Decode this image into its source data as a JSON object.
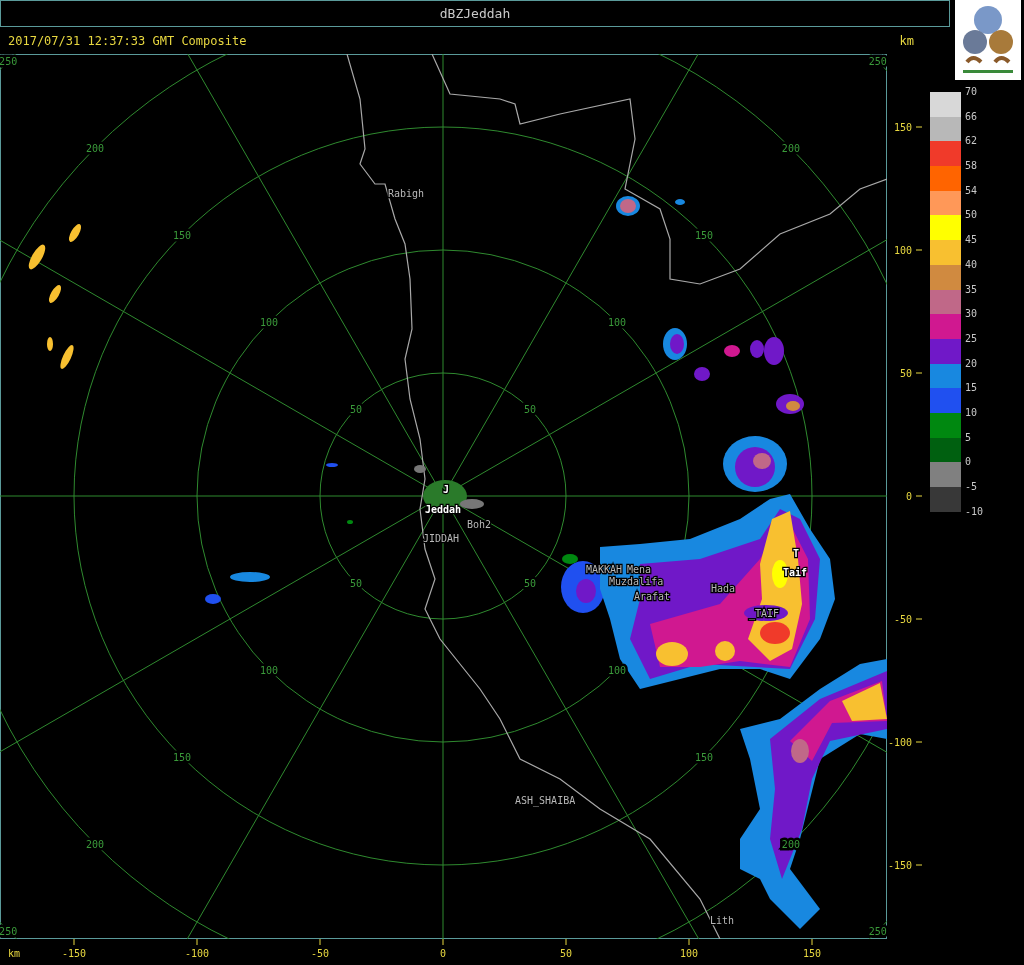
{
  "window": {
    "title": "dBZJeddah"
  },
  "header": {
    "timestamp": "2017/07/31 12:37:33 GMT Composite"
  },
  "range_rings": [
    {
      "labels": [
        "50",
        "50",
        "50",
        "50"
      ]
    },
    {
      "labels": [
        "100",
        "100",
        "100",
        "100"
      ]
    },
    {
      "labels": [
        "150",
        "150",
        "150",
        "150"
      ]
    },
    {
      "labels": [
        "200",
        "200",
        "200",
        "200"
      ]
    },
    {
      "labels": [
        "250",
        "250",
        "250",
        "250"
      ]
    }
  ],
  "places": [
    {
      "name": "Rabigh",
      "kind": "town"
    },
    {
      "name": "J",
      "kind": "radar"
    },
    {
      "name": "Jeddah",
      "kind": "radar"
    },
    {
      "name": "Boh2",
      "kind": "town"
    },
    {
      "name": "JIDDAH",
      "kind": "town"
    },
    {
      "name": "MAKKAH",
      "kind": "town"
    },
    {
      "name": "Mena",
      "kind": "town"
    },
    {
      "name": "Muzdalifa",
      "kind": "town"
    },
    {
      "name": "Arafat",
      "kind": "town"
    },
    {
      "name": "Hada",
      "kind": "town"
    },
    {
      "name": "T",
      "kind": "radar"
    },
    {
      "name": "Taif",
      "kind": "radar"
    },
    {
      "name": "_TAIF",
      "kind": "town"
    },
    {
      "name": "ASH_SHAIBA",
      "kind": "town"
    },
    {
      "name": "Lith",
      "kind": "town"
    }
  ],
  "x_axis": {
    "unit": "km",
    "ticks": [
      "-150",
      "-100",
      "-50",
      "0",
      "50",
      "100",
      "150"
    ]
  },
  "y_axis": {
    "unit": "km",
    "ticks": [
      "150",
      "100",
      "50",
      "0",
      "-50",
      "-100",
      "-150"
    ]
  },
  "legend": {
    "bands": [
      {
        "label": "70",
        "color": "#d8d8d8"
      },
      {
        "label": "66",
        "color": "#b8b8b8"
      },
      {
        "label": "62",
        "color": "#f03a2a"
      },
      {
        "label": "58",
        "color": "#ff6400"
      },
      {
        "label": "54",
        "color": "#ff9858"
      },
      {
        "label": "50",
        "color": "#ffff00"
      },
      {
        "label": "45",
        "color": "#f8c030"
      },
      {
        "label": "40",
        "color": "#d08a40"
      },
      {
        "label": "35",
        "color": "#c06888"
      },
      {
        "label": "30",
        "color": "#d01890"
      },
      {
        "label": "25",
        "color": "#7018c8"
      },
      {
        "label": "20",
        "color": "#1888e0"
      },
      {
        "label": "15",
        "color": "#2050f0"
      },
      {
        "label": "10",
        "color": "#008810"
      },
      {
        "label": "5",
        "color": "#006010"
      },
      {
        "label": "0",
        "color": "#808080"
      },
      {
        "label": "-5",
        "color": "#383838"
      }
    ],
    "bottom_label": "-10"
  }
}
